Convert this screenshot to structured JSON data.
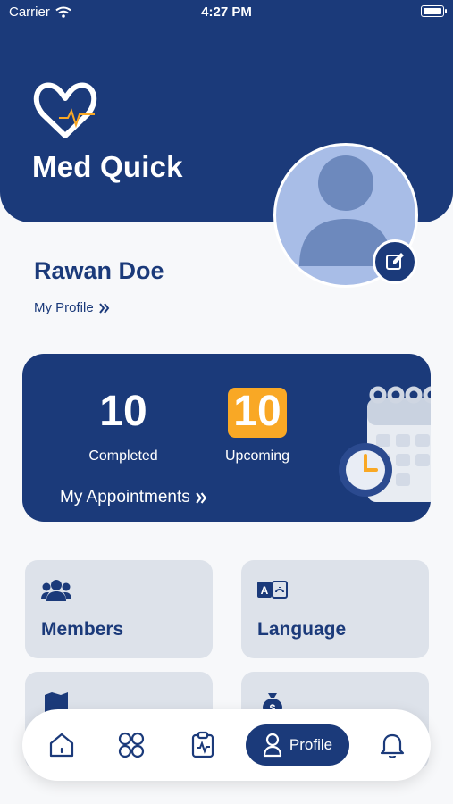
{
  "status_bar": {
    "carrier": "Carrier",
    "time": "4:27 PM"
  },
  "header": {
    "brand": "Med Quick"
  },
  "profile": {
    "name": "Rawan Doe",
    "link_label": "My Profile"
  },
  "appointments": {
    "completed": {
      "value": "10",
      "label": "Completed"
    },
    "upcoming": {
      "value": "10",
      "label": "Upcoming"
    },
    "link_label": "My Appointments"
  },
  "tiles": [
    {
      "label": "Members",
      "icon": "members-icon"
    },
    {
      "label": "Language",
      "icon": "language-icon"
    },
    {
      "label": "",
      "icon": "map-icon"
    },
    {
      "label": "",
      "icon": "money-icon"
    }
  ],
  "tabbar": {
    "items": [
      {
        "name": "home",
        "icon": "home-icon"
      },
      {
        "name": "services",
        "icon": "grid-icon"
      },
      {
        "name": "records",
        "icon": "clipboard-icon"
      },
      {
        "name": "profile",
        "icon": "user-icon",
        "label": "Profile",
        "active": true
      },
      {
        "name": "notifications",
        "icon": "bell-icon"
      }
    ]
  },
  "colors": {
    "primary": "#1b3a7a",
    "accent": "#f9a825",
    "tile_bg": "#dde2ea",
    "avatar_bg": "#a8bde7"
  }
}
